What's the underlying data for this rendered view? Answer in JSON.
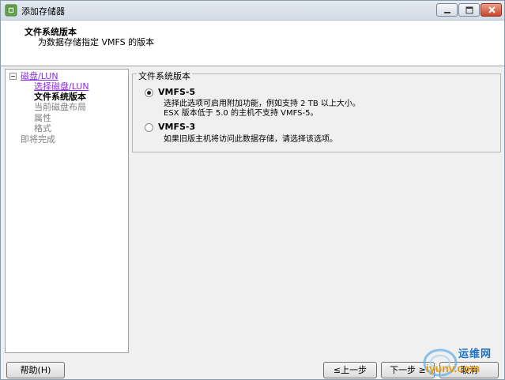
{
  "window": {
    "title": "添加存储器"
  },
  "header": {
    "title": "文件系统版本",
    "subtitle": "为数据存储指定 VMFS 的版本"
  },
  "nav": {
    "items": [
      {
        "label": "磁盘/LUN",
        "state": "link"
      },
      {
        "label": "选择磁盘/LUN",
        "state": "link"
      },
      {
        "label": "文件系统版本",
        "state": "current"
      },
      {
        "label": "当前磁盘布局",
        "state": "disabled"
      },
      {
        "label": "属性",
        "state": "disabled"
      },
      {
        "label": "格式",
        "state": "disabled"
      },
      {
        "label": "即将完成",
        "state": "disabled"
      }
    ]
  },
  "content": {
    "group_title": "文件系统版本",
    "options": [
      {
        "label": "VMFS-5",
        "checked": true,
        "desc_line1": "选择此选项可启用附加功能，例如支持 2 TB 以上大小。",
        "desc_line2": "ESX 版本低于 5.0 的主机不支持 VMFS-5。"
      },
      {
        "label": "VMFS-3",
        "checked": false,
        "desc_line1": "如果旧版主机将访问此数据存储，请选择该选项。"
      }
    ]
  },
  "buttons": {
    "help": "帮助(H)",
    "back": "≤上一步",
    "next": "下一步 ≥",
    "cancel": "取消"
  },
  "watermark": {
    "text_cn": "运维网",
    "text_en": "iyunv.com"
  },
  "icons": {
    "app": "vsphere-app-icon",
    "minimize": "minimize-icon",
    "maximize": "maximize-icon",
    "close": "close-icon",
    "tree_toggle": "tree-collapse-icon"
  }
}
